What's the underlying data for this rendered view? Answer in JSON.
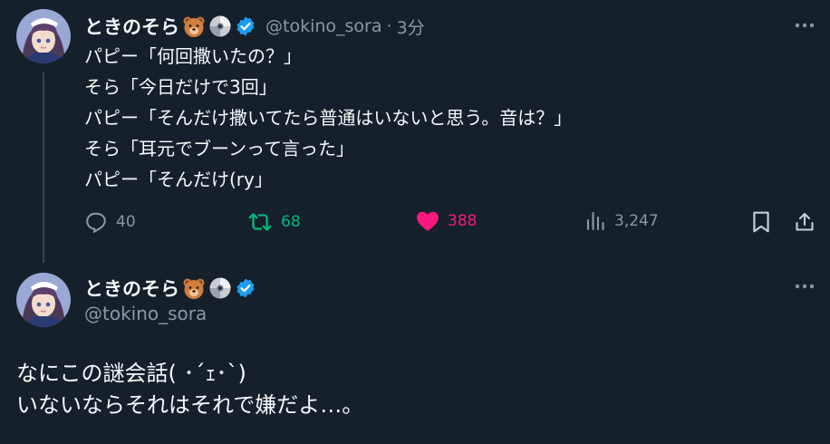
{
  "tweet1": {
    "display_name": "ときのそら",
    "handle": "@tokino_sora",
    "separator": "·",
    "time": "3分",
    "lines": [
      "パピー「何回撒いたの？」",
      "そら「今日だけで3回」",
      "パピー「そんだけ撒いてたら普通はいないと思う。音は？」",
      "そら「耳元でブーンって言った」",
      "パピー「そんだけ(ry」"
    ],
    "actions": {
      "replies": "40",
      "retweets": "68",
      "likes": "388",
      "views": "3,247"
    }
  },
  "tweet2": {
    "display_name": "ときのそら",
    "handle": "@tokino_sora",
    "lines": [
      "なにこの謎会話( ･´ｪ･`)",
      "いないならそれはそれで嫌だよ…。"
    ]
  },
  "icons": {
    "name_emoji_1": "bear-face-icon",
    "name_emoji_2": "optical-disc-icon",
    "verified": "verified-badge-icon",
    "more": "more-icon",
    "reply": "reply-icon",
    "retweet": "retweet-icon",
    "like": "heart-icon",
    "views": "views-icon",
    "bookmark": "bookmark-icon",
    "share": "share-icon"
  },
  "colors": {
    "background": "#15202b",
    "text": "#f7f9f9",
    "muted": "#8b98a5",
    "retweet": "#00ba7c",
    "like": "#f91880",
    "verified": "#1d9bf0"
  }
}
